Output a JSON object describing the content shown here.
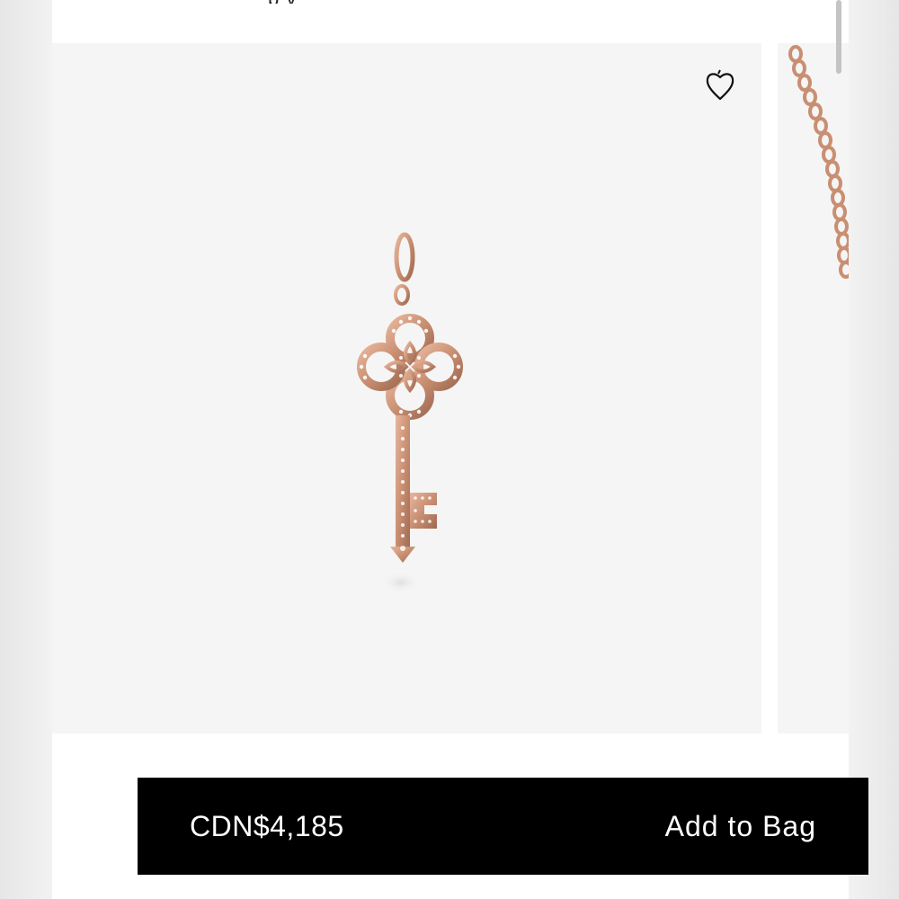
{
  "header": {
    "partial_title": "p  y"
  },
  "gallery": {
    "wishlist_icon": "heart-icon",
    "main_image": "rose-gold-diamond-key-pendant",
    "next_image": "rose-gold-chain"
  },
  "purchase": {
    "price": "CDN$4,185",
    "add_label": "Add to Bag"
  },
  "colors": {
    "metal": "#c98f72",
    "bar": "#000000",
    "background": "#f5f5f5"
  }
}
